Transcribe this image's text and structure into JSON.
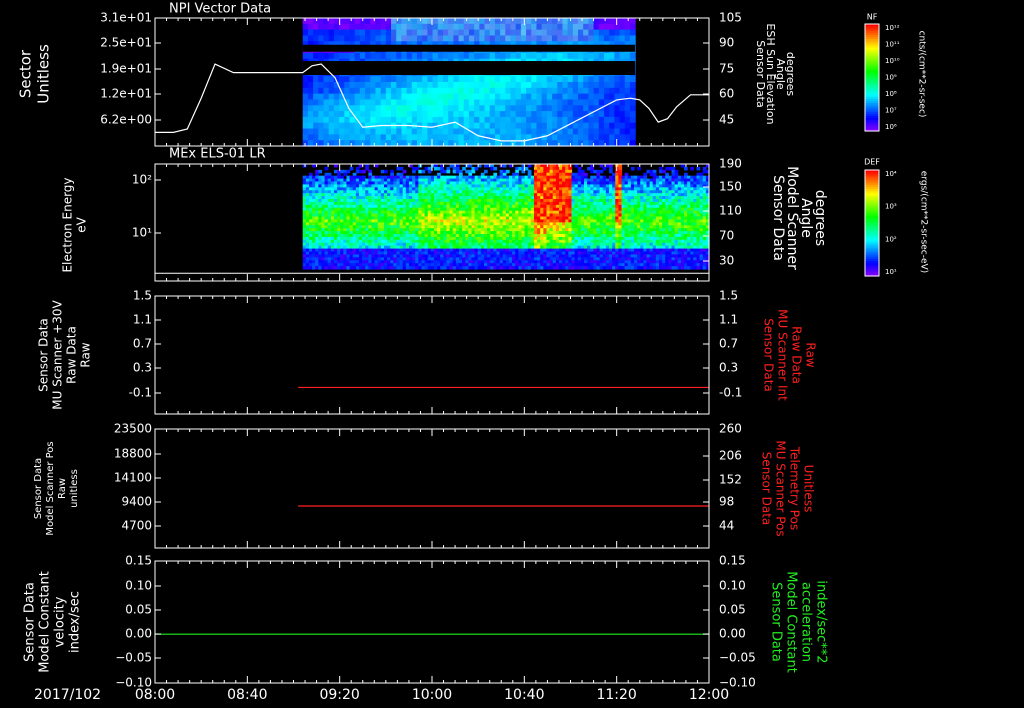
{
  "colors": {
    "background": "#000000",
    "frame": "#ffffff",
    "red_trace": "#ff2020",
    "green_trace": "#22ee22",
    "red_label": "#ff2020",
    "green_label": "#22ee22",
    "spectro_low": "#6a00ff",
    "spectro_high": "#ff1010"
  },
  "time_axis": {
    "date_label": "2017/102",
    "ticks": [
      "08:00",
      "08:40",
      "09:20",
      "10:00",
      "10:40",
      "11:20",
      "12:00"
    ],
    "start": "08:00",
    "end": "12:00"
  },
  "chart_data": [
    {
      "type": "heatmap",
      "title": "NPI Vector Data",
      "ylabel": [
        "Sector",
        "Unitless"
      ],
      "yticks": [
        "3.1e+01",
        "2.5e+01",
        "1.9e+01",
        "1.2e+01",
        "6.2e+00"
      ],
      "y2label": [
        "Sensor Data",
        "ESH Sun Elevation",
        "Angle",
        "degrees"
      ],
      "y2ticks": [
        "105",
        "90",
        "75",
        "60",
        "45"
      ],
      "data_start": "09:04",
      "data_end": "11:28",
      "colorbar": {
        "label": "NF",
        "units": "cnts/(cm**2-sr-sec)",
        "ticks": [
          "10¹²",
          "10¹¹",
          "10¹⁰",
          "10⁹",
          "10⁸",
          "10⁷",
          "10⁶"
        ]
      },
      "overlay_line": {
        "name": "",
        "x": [
          "08:00",
          "08:08",
          "08:14",
          "08:20",
          "08:26",
          "08:34",
          "08:40",
          "09:00",
          "09:04",
          "09:08",
          "09:12",
          "09:18",
          "09:24",
          "09:30",
          "09:38",
          "09:50",
          "10:00",
          "10:10",
          "10:20",
          "10:30",
          "10:40",
          "10:50",
          "11:00",
          "11:10",
          "11:20",
          "11:26",
          "11:30",
          "11:34",
          "11:38",
          "11:42",
          "11:46",
          "11:52",
          "11:58",
          "12:00"
        ],
        "y": [
          38,
          38,
          40,
          58,
          78,
          73,
          73,
          73,
          73,
          77,
          78,
          70,
          52,
          41,
          42,
          42,
          41,
          44,
          36,
          33,
          33,
          36,
          43,
          50,
          57,
          58,
          57,
          52,
          44,
          46,
          53,
          60,
          60,
          60
        ]
      }
    },
    {
      "type": "heatmap",
      "title": "MEx ELS-01 LR",
      "ylabel": [
        "Electron Energy",
        "eV"
      ],
      "yticks": [
        "10²",
        "10¹"
      ],
      "y2label": [
        "Sensor Data",
        "Model Scanner",
        "Angle",
        "degrees"
      ],
      "y2ticks": [
        "190",
        "150",
        "110",
        "70",
        "30"
      ],
      "data_start": "09:04",
      "data_end": "12:00",
      "colorbar": {
        "label": "DEF",
        "units": "ergs/(cm**2-sr-sec-eV)",
        "ticks": [
          "10⁴",
          "10³",
          "10²",
          "10¹"
        ]
      },
      "overlay_line": {
        "name": "",
        "x": [
          "08:00",
          "12:00"
        ],
        "y": [
          22,
          22
        ]
      }
    },
    {
      "type": "line",
      "ylabel": [
        "Sensor Data",
        "MU Scanner +30V",
        "Raw Data",
        "Raw"
      ],
      "yticks": [
        "1.5",
        "1.1",
        "0.7",
        "0.3",
        "-0.1"
      ],
      "y2label": [
        "Sensor Data",
        "MU Scanner Int",
        "Raw Data",
        "Raw"
      ],
      "y2ticks": [
        "1.5",
        "1.1",
        "0.7",
        "0.3",
        "-0.1"
      ],
      "ylim": [
        -0.5,
        1.5
      ],
      "series": [
        {
          "x": [
            "09:02",
            "12:00"
          ],
          "y": [
            -0.05,
            -0.05
          ]
        }
      ]
    },
    {
      "type": "line",
      "ylabel": [
        "Sensor Data",
        "Model Scanner Pos",
        "Raw",
        "unitless"
      ],
      "yticks": [
        "23500",
        "18800",
        "14100",
        "9400",
        "4700"
      ],
      "y2label": [
        "Sensor Data",
        "MU Scanner Pos",
        "Telemetry Pos",
        "Unitless"
      ],
      "y2ticks": [
        "260",
        "206",
        "152",
        "98",
        "44"
      ],
      "ylim": [
        0,
        23500
      ],
      "series": [
        {
          "x": [
            "09:02",
            "12:00"
          ],
          "y": [
            8300,
            8300
          ]
        }
      ]
    },
    {
      "type": "line",
      "ylabel": [
        "Sensor Data",
        "Model Constant",
        "velocity",
        "index/sec"
      ],
      "yticks": [
        "0.15",
        "0.10",
        "0.05",
        "0.00",
        "−0.05",
        "−0.10"
      ],
      "y2label": [
        "Sensor Data",
        "Model Constant",
        "acceleration",
        "index/sec**2"
      ],
      "y2ticks": [
        "0.15",
        "0.10",
        "0.05",
        "0.00",
        "−0.05",
        "−0.10"
      ],
      "ylim": [
        -0.1,
        0.15
      ],
      "series": [
        {
          "x": [
            "08:00",
            "12:00"
          ],
          "y": [
            0.0,
            0.0
          ]
        }
      ]
    }
  ]
}
